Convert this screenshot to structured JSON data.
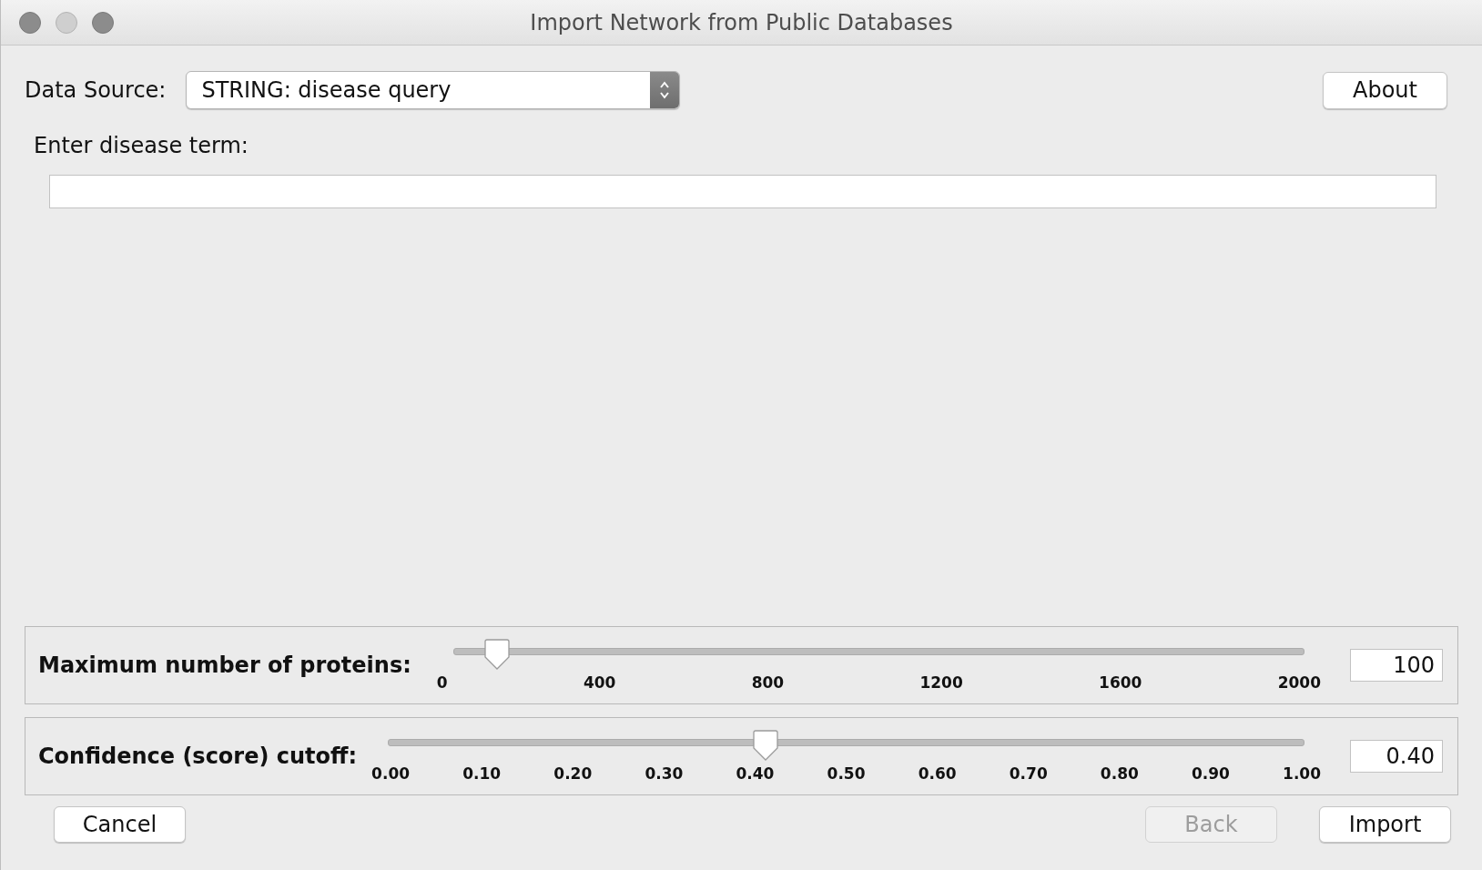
{
  "window": {
    "title": "Import Network from Public Databases"
  },
  "data_source": {
    "label": "Data Source:",
    "value": "STRING: disease query"
  },
  "about_button": "About",
  "query": {
    "label": "Enter disease term:"
  },
  "sliders": [
    {
      "label": "Maximum number of proteins:",
      "level": 0.05,
      "ticks": [
        "0",
        "400",
        "800",
        "1200",
        "1600",
        "2000"
      ],
      "value": "100"
    },
    {
      "label": "Confidence (score) cutoff:",
      "level": 0.4,
      "ticks": [
        "0.00",
        "0.10",
        "0.20",
        "0.30",
        "0.40",
        "0.50",
        "0.60",
        "0.70",
        "0.80",
        "0.90",
        "1.00"
      ],
      "value": "0.40"
    }
  ],
  "buttons": [
    {
      "kind": "left",
      "label": "Cancel",
      "disabled": false
    },
    {
      "kind": "right",
      "label": "Back",
      "disabled": true
    },
    {
      "kind": "right",
      "label": "Import",
      "disabled": false
    }
  ]
}
